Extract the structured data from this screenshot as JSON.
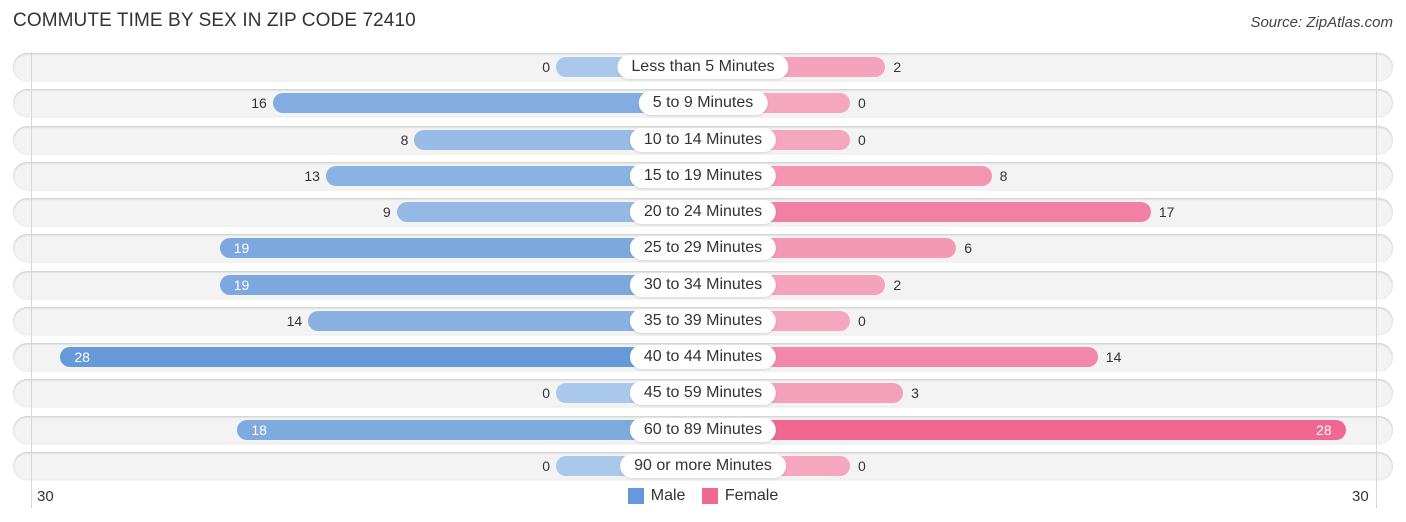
{
  "title": "COMMUTE TIME BY SEX IN ZIP CODE 72410",
  "source": "Source: ZipAtlas.com",
  "colors": {
    "male_strong": "#6699d8",
    "male_light": "#a9c8ea",
    "female_strong": "#f06792",
    "female_light": "#f5a7bf"
  },
  "chart_data": {
    "type": "bar",
    "orientation": "horizontal-diverging",
    "title": "COMMUTE TIME BY SEX IN ZIP CODE 72410",
    "categories": [
      "Less than 5 Minutes",
      "5 to 9 Minutes",
      "10 to 14 Minutes",
      "15 to 19 Minutes",
      "20 to 24 Minutes",
      "25 to 29 Minutes",
      "30 to 34 Minutes",
      "35 to 39 Minutes",
      "40 to 44 Minutes",
      "45 to 59 Minutes",
      "60 to 89 Minutes",
      "90 or more Minutes"
    ],
    "series": [
      {
        "name": "Male",
        "values": [
          0,
          16,
          8,
          13,
          9,
          19,
          19,
          14,
          28,
          0,
          18,
          0
        ]
      },
      {
        "name": "Female",
        "values": [
          2,
          0,
          0,
          8,
          17,
          6,
          2,
          0,
          14,
          3,
          28,
          0
        ]
      }
    ],
    "axis": {
      "left_tick": "30",
      "right_tick": "30",
      "range": [
        0,
        30
      ]
    },
    "legend": {
      "position": "bottom-center",
      "entries": [
        "Male",
        "Female"
      ]
    },
    "grid": false
  }
}
